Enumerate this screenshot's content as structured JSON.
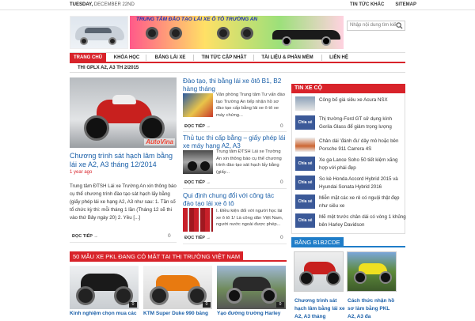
{
  "topbar": {
    "day": "TUESDAY,",
    "date": "DECEMBER 22ND",
    "links": [
      "TIN TỨC KHÁC",
      "SITEMAP"
    ]
  },
  "header": {
    "banner_text": "TRUNG TÂM ĐÀO TẠO LÁI XE Ô TÔ TRƯỜNG AN"
  },
  "search": {
    "placeholder": "Nhập nội dung tìm kiế"
  },
  "nav": {
    "items": [
      "TRANG CHỦ",
      "KHÓA HỌC",
      "BẢNG LÁI XE",
      "TIN TỨC CẬP NHẬT",
      "TÀI LIỆU & PHẦN MỀM",
      "LIÊN HỆ"
    ],
    "active": 0,
    "sub": "THI GPLX A2, A3 TH 2/2015"
  },
  "featured": {
    "badge": "AutoVina",
    "title": "Chương trình sát hạch lâm bằng lái xe A2, A3 tháng 12/2014",
    "time": "1 year ago",
    "desc": "Trung tâm ĐTSH Lái xe Trường An xin thông báo cụ thể chương trình đào tạo sát hạch lấy bằng (giấy phép lái xe hạng A2, A3 như sau: 1. Tần số tổ chức kỳ thi: mỗi tháng 1 lần (Tháng 12 sẽ thi vào thứ Bảy ngày 20) 2. Yêu [...]",
    "more": "ĐỌC TIẾP →",
    "count": "0"
  },
  "posts": [
    {
      "title": "Đào tạo, thi bằng lái xe ôtô B1, B2 hàng tháng",
      "desc": "Văn phòng Trung tâm Tư vấn đào tạo Trường An tiếp nhận hồ sơ đào tạo cấp bằng lái xe ô tô xe máy chứng...",
      "more": "ĐỌC TIẾP →",
      "count": "0"
    },
    {
      "title": "Thủ tục thi cấp bằng – giấy phép lái xe máy hạng A2, A3",
      "desc": "Trung tâm ĐTSH Lái xe Trường An xin thông báo cụ thể chương trình đào tạo sát hạch lấy bằng (giấy...",
      "more": "ĐỌC TIẾP →",
      "count": "0"
    },
    {
      "title": "Qui định chung đổi với công tác đào tạo lái xe ô tô",
      "desc": "I. Điều kiện đối với người học lái xe ô tô 1/ Là công dân Việt Nam, người nước ngoài được phép...",
      "more": "ĐỌC TIẾP →",
      "count": "0"
    }
  ],
  "tinxe": {
    "heading": "TIN XE CỘ",
    "thumb_label": "Chia sẻ",
    "items": [
      "Công bố giá siêu xe Acura NSX",
      "Thị trường-Ford GT sử dụng kính Gorila Glass để giảm trọng lượng",
      "Chân dài 'đánh đu' dây mô hoặc bên Porsche 911 Carrera 4S",
      "Xe ga Lance Soho 50 tiết kiệm xăng hợp với phái đẹp",
      "So kè Honda Accord Hybrid 2015 và Hyundai Sonata Hybrid 2016",
      "Miễn mặt các xe rẻ có nguội thật đẹp như siêu xe",
      "Mẽ mệt trước chân dài có vòng 1 khủng bên Harley Davidson"
    ]
  },
  "pkl": {
    "heading": "50 MẪU XE PKL ĐANG CÓ MẶT TẠI THỊ TRƯỜNG VIỆT NAM",
    "items": [
      {
        "title": "Kinh nghiệm chọn mua các",
        "count": "0"
      },
      {
        "title": "KTM Super Duke 990 bằng",
        "count": "0"
      },
      {
        "title": "Yạo đường trường Harley",
        "count": "0"
      }
    ]
  },
  "bang": {
    "heading": "BẰNG B1B2CDE",
    "items": [
      {
        "title": "Chương trình sát hạch lâm bằng lái xe A2, A3 tháng"
      },
      {
        "title": "Cách thức nhận hồ sơ làm bằng PKL A2, A3 đa"
      }
    ]
  },
  "colors": {
    "accent": "#d8232a",
    "link": "#1a5fa8",
    "blue_tab": "#1f7dc8"
  }
}
